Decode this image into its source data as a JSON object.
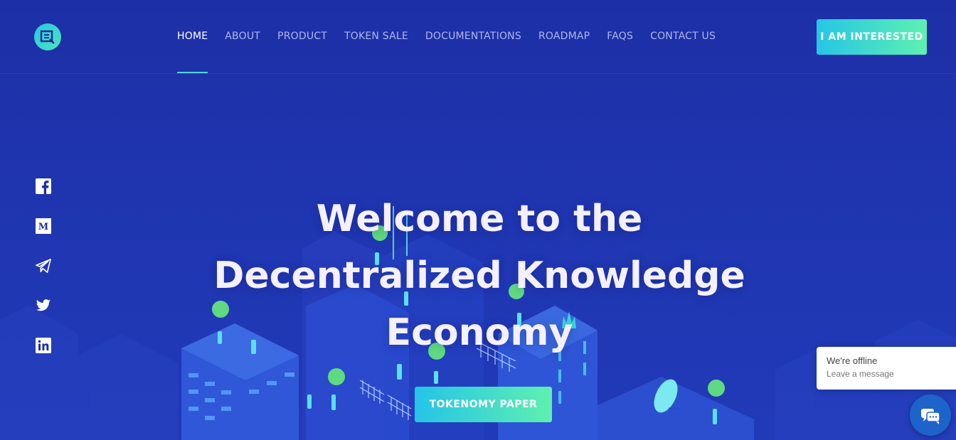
{
  "brand": {
    "logo_icon": "erudito-logo-icon"
  },
  "nav": {
    "items": [
      {
        "label": "HOME",
        "active": true
      },
      {
        "label": "ABOUT",
        "active": false
      },
      {
        "label": "PRODUCT",
        "active": false
      },
      {
        "label": "TOKEN SALE",
        "active": false
      },
      {
        "label": "DOCUMENTATIONS",
        "active": false
      },
      {
        "label": "ROADMAP",
        "active": false
      },
      {
        "label": "FAQS",
        "active": false
      },
      {
        "label": "CONTACT US",
        "active": false
      }
    ]
  },
  "header": {
    "cta_label": "I AM INTERESTED"
  },
  "social": [
    "facebook-icon",
    "medium-icon",
    "telegram-icon",
    "twitter-icon",
    "linkedin-icon"
  ],
  "hero": {
    "line1": "Welcome to the",
    "line2": "Decentralized Knowledge",
    "line3": "Economy",
    "button_label": "TOKENOMY PAPER"
  },
  "chat": {
    "status": "We're offline",
    "prompt": "Leave a message",
    "icon": "chat-bubble-icon"
  },
  "colors": {
    "background": "#1a2fa8",
    "accent_start": "#25c6e6",
    "accent_end": "#5ef0b0",
    "nav_active_underline": "#4fd6d8"
  }
}
